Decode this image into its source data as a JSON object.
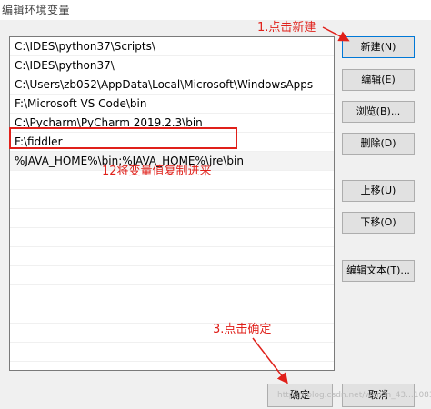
{
  "window": {
    "title": "编辑环境变量"
  },
  "list": {
    "items": [
      "C:\\IDES\\python37\\Scripts\\",
      "C:\\IDES\\python37\\",
      "C:\\Users\\zb052\\AppData\\Local\\Microsoft\\WindowsApps",
      "F:\\Microsoft VS Code\\bin",
      "C:\\Pycharm\\PyCharm 2019.2.3\\bin",
      "F:\\fiddler",
      "%JAVA_HOME%\\bin;%JAVA_HOME%\\jre\\bin"
    ],
    "selected_index": 6
  },
  "buttons": {
    "new": "新建(N)",
    "edit": "编辑(E)",
    "browse": "浏览(B)...",
    "delete": "删除(D)",
    "move_up": "上移(U)",
    "move_down": "下移(O)",
    "edit_text": "编辑文本(T)...",
    "ok": "确定",
    "cancel": "取消"
  },
  "annotations": {
    "step1": "1.点击新建",
    "step2": "12将变量值复制进来",
    "step3": "3.点击确定",
    "color": "#e0201a"
  },
  "watermark": "https://blog.csdn.net/weixin_43...1083"
}
